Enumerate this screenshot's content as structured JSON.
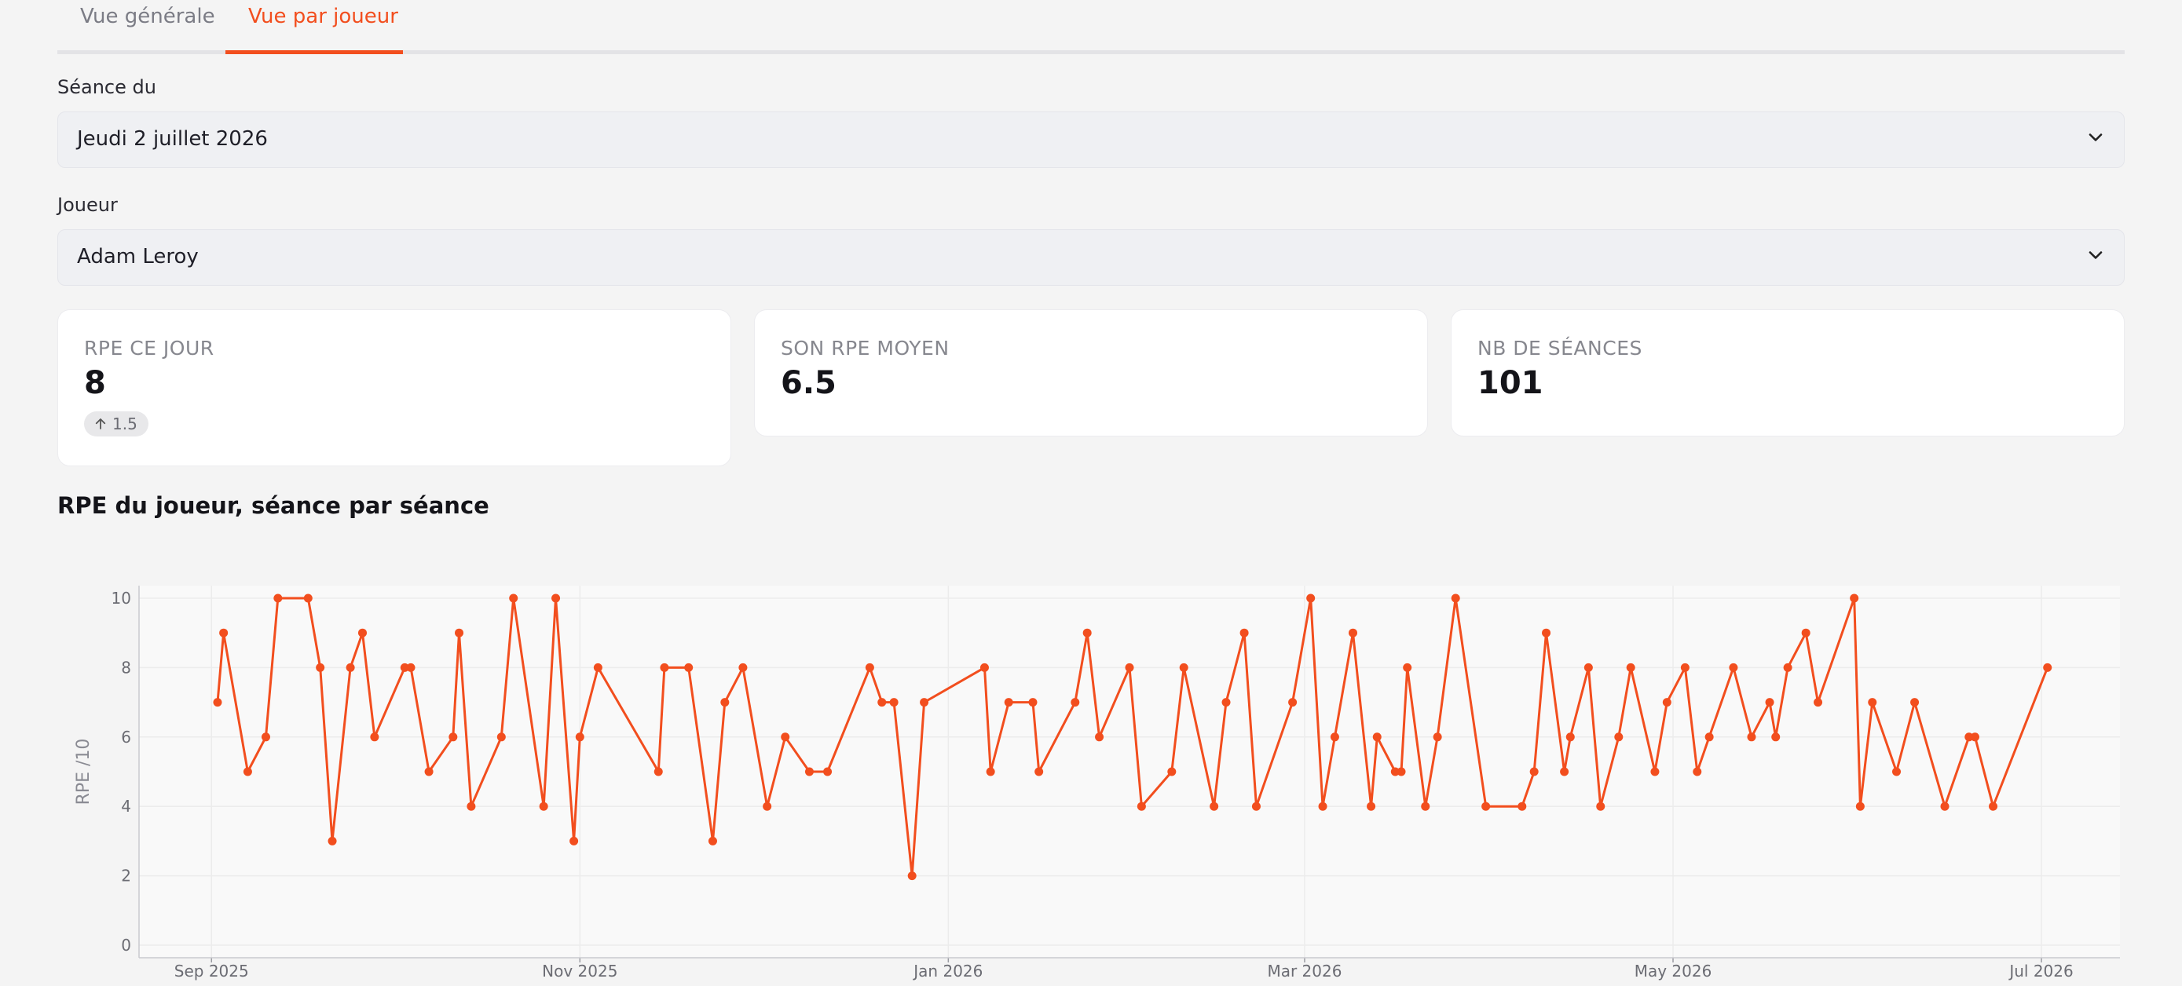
{
  "tabs": [
    {
      "label": "Vue générale",
      "active": false
    },
    {
      "label": "Vue par joueur",
      "active": true
    }
  ],
  "session": {
    "label": "Séance du",
    "value": "Jeudi 2 juillet 2026"
  },
  "player": {
    "label": "Joueur",
    "value": "Adam Leroy"
  },
  "kpis": [
    {
      "label": "RPE CE JOUR",
      "value": "8",
      "delta": "1.5",
      "delta_icon": "arrow-up-icon"
    },
    {
      "label": "SON RPE MOYEN",
      "value": "6.5"
    },
    {
      "label": "NB DE SÉANCES",
      "value": "101"
    }
  ],
  "colors": {
    "accent": "#f24e1e",
    "tab_inactive": "#7b7c85",
    "plot_bg": "#f9f9f9",
    "grid": "#ececec"
  },
  "chart_title": "RPE du joueur, séance par séance",
  "chart_data": {
    "type": "line",
    "title": "RPE du joueur, séance par séance",
    "xlabel": "",
    "ylabel": "RPE /10",
    "ylim": [
      0,
      10
    ],
    "yticks": [
      0,
      2,
      4,
      6,
      8,
      10
    ],
    "xlim": [
      "2025-08-20",
      "2026-07-14"
    ],
    "xticks": [
      {
        "date": "2025-09-01",
        "label": "Sep 2025"
      },
      {
        "date": "2025-11-01",
        "label": "Nov 2025"
      },
      {
        "date": "2026-01-01",
        "label": "Jan 2026"
      },
      {
        "date": "2026-03-01",
        "label": "Mar 2026"
      },
      {
        "date": "2026-05-01",
        "label": "May 2026"
      },
      {
        "date": "2026-07-01",
        "label": "Jul 2026"
      }
    ],
    "grid": true,
    "series": [
      {
        "color": "#f24e1e",
        "x": [
          "2025-09-02",
          "2025-09-03",
          "2025-09-07",
          "2025-09-10",
          "2025-09-12",
          "2025-09-17",
          "2025-09-19",
          "2025-09-21",
          "2025-09-24",
          "2025-09-26",
          "2025-09-28",
          "2025-10-03",
          "2025-10-04",
          "2025-10-07",
          "2025-10-11",
          "2025-10-12",
          "2025-10-14",
          "2025-10-19",
          "2025-10-21",
          "2025-10-26",
          "2025-10-28",
          "2025-10-31",
          "2025-11-01",
          "2025-11-04",
          "2025-11-14",
          "2025-11-15",
          "2025-11-19",
          "2025-11-23",
          "2025-11-25",
          "2025-11-28",
          "2025-12-02",
          "2025-12-05",
          "2025-12-09",
          "2025-12-12",
          "2025-12-19",
          "2025-12-21",
          "2025-12-23",
          "2025-12-26",
          "2025-12-28",
          "2026-01-07",
          "2026-01-08",
          "2026-01-11",
          "2026-01-15",
          "2026-01-16",
          "2026-01-22",
          "2026-01-24",
          "2026-01-26",
          "2026-01-31",
          "2026-02-02",
          "2026-02-07",
          "2026-02-09",
          "2026-02-14",
          "2026-02-16",
          "2026-02-19",
          "2026-02-21",
          "2026-02-27",
          "2026-03-02",
          "2026-03-04",
          "2026-03-06",
          "2026-03-09",
          "2026-03-12",
          "2026-03-13",
          "2026-03-16",
          "2026-03-17",
          "2026-03-18",
          "2026-03-21",
          "2026-03-23",
          "2026-03-26",
          "2026-03-31",
          "2026-04-06",
          "2026-04-08",
          "2026-04-10",
          "2026-04-13",
          "2026-04-14",
          "2026-04-17",
          "2026-04-19",
          "2026-04-22",
          "2026-04-24",
          "2026-04-28",
          "2026-04-30",
          "2026-05-03",
          "2026-05-05",
          "2026-05-07",
          "2026-05-11",
          "2026-05-14",
          "2026-05-17",
          "2026-05-18",
          "2026-05-20",
          "2026-05-23",
          "2026-05-25",
          "2026-05-31",
          "2026-06-01",
          "2026-06-03",
          "2026-06-07",
          "2026-06-10",
          "2026-06-15",
          "2026-06-19",
          "2026-06-20",
          "2026-06-23",
          "2026-07-02"
        ],
        "y": [
          7,
          9,
          5,
          6,
          10,
          10,
          8,
          3,
          8,
          9,
          6,
          8,
          8,
          5,
          6,
          9,
          4,
          6,
          10,
          4,
          10,
          3,
          6,
          8,
          5,
          8,
          8,
          3,
          7,
          8,
          4,
          6,
          5,
          5,
          8,
          7,
          7,
          2,
          7,
          8,
          5,
          7,
          7,
          5,
          7,
          9,
          6,
          8,
          4,
          5,
          8,
          4,
          7,
          9,
          4,
          7,
          10,
          4,
          6,
          9,
          4,
          6,
          5,
          5,
          8,
          4,
          6,
          10,
          4,
          4,
          5,
          9,
          5,
          6,
          8,
          4,
          6,
          8,
          5,
          7,
          8,
          5,
          6,
          8,
          6,
          7,
          6,
          8,
          9,
          7,
          10,
          4,
          7,
          5,
          7,
          4,
          6,
          6,
          4,
          8
        ]
      }
    ]
  }
}
